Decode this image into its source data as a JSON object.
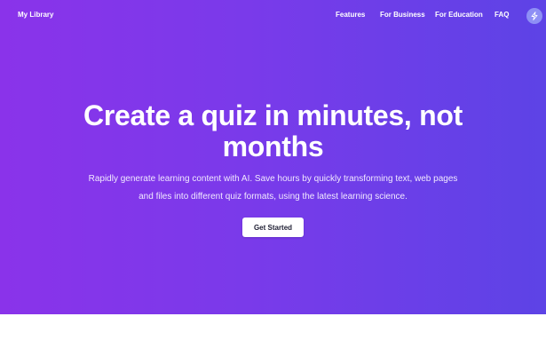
{
  "nav": {
    "brand": "My Library",
    "links": [
      "Features",
      "For Business",
      "For Education",
      "FAQ"
    ],
    "action_icon": "lightning-icon"
  },
  "hero": {
    "headline_lines": [
      "Create a quiz in minutes, not",
      "months"
    ],
    "subtext_lines": [
      "Rapidly generate learning content with AI. Save hours by quickly transforming text, web pages",
      "and files into different quiz formats, using the latest learning science."
    ],
    "cta_label": "Get Started"
  },
  "colors": {
    "gradient_start": "#8a33ea",
    "gradient_end": "#5d43e6",
    "icon_button": "#8e8ff5",
    "cta_background": "#ffffff",
    "cta_text": "#1f1f33"
  }
}
